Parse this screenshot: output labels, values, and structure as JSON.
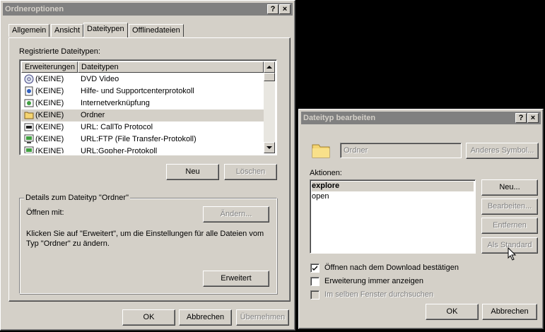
{
  "main_window": {
    "title": "Ordneroptionen",
    "tabs": [
      "Allgemein",
      "Ansicht",
      "Dateitypen",
      "Offlinedateien"
    ],
    "registered_label": "Registrierte Dateitypen:",
    "columns": [
      "Erweiterungen",
      "Dateitypen"
    ],
    "rows": [
      {
        "ext": "(KEINE)",
        "type": "DVD Video",
        "icon": "dvd-icon"
      },
      {
        "ext": "(KEINE)",
        "type": "Hilfe- und Supportcenterprotokoll",
        "icon": "document-icon"
      },
      {
        "ext": "(KEINE)",
        "type": "Internetverknüpfung",
        "icon": "globe-icon"
      },
      {
        "ext": "(KEINE)",
        "type": "Ordner",
        "icon": "folder-icon"
      },
      {
        "ext": "(KEINE)",
        "type": "URL: CallTo Protocol",
        "icon": "phone-icon"
      },
      {
        "ext": "(KEINE)",
        "type": "URL:FTP (File Transfer-Protokoll)",
        "icon": "network-icon"
      },
      {
        "ext": "(KEINE)",
        "type": "URL:Gopher-Protokoll",
        "icon": "network-icon"
      }
    ],
    "new_button": "Neu",
    "delete_button": "Löschen",
    "details_title": "Details zum Dateityp \"Ordner\"",
    "open_with_label": "Öffnen mit:",
    "change_button": "Ändern...",
    "info_text_line1": "Klicken Sie auf \"Erweitert\", um die Einstellungen für alle Dateien vom",
    "info_text_line2": "Typ \"Ordner\" zu ändern.",
    "advanced_button": "Erweitert",
    "ok_button": "OK",
    "cancel_button": "Abbrechen",
    "apply_button": "Übernehmen"
  },
  "edit_dialog": {
    "title": "Dateityp bearbeiten",
    "type_name": "Ordner",
    "change_icon_button": "Anderes Symbol...",
    "actions_label": "Aktionen:",
    "actions": [
      "explore",
      "open"
    ],
    "new_button": "Neu...",
    "edit_button": "Bearbeiten...",
    "remove_button": "Entfernen",
    "default_button": "Als Standard",
    "confirm_download": "Öffnen nach dem Download bestätigen",
    "always_show_ext": "Erweiterung immer anzeigen",
    "same_window": "Im selben Fenster durchsuchen",
    "ok_button": "OK",
    "cancel_button": "Abbrechen"
  },
  "titlebar_help": "?",
  "titlebar_close": "×"
}
